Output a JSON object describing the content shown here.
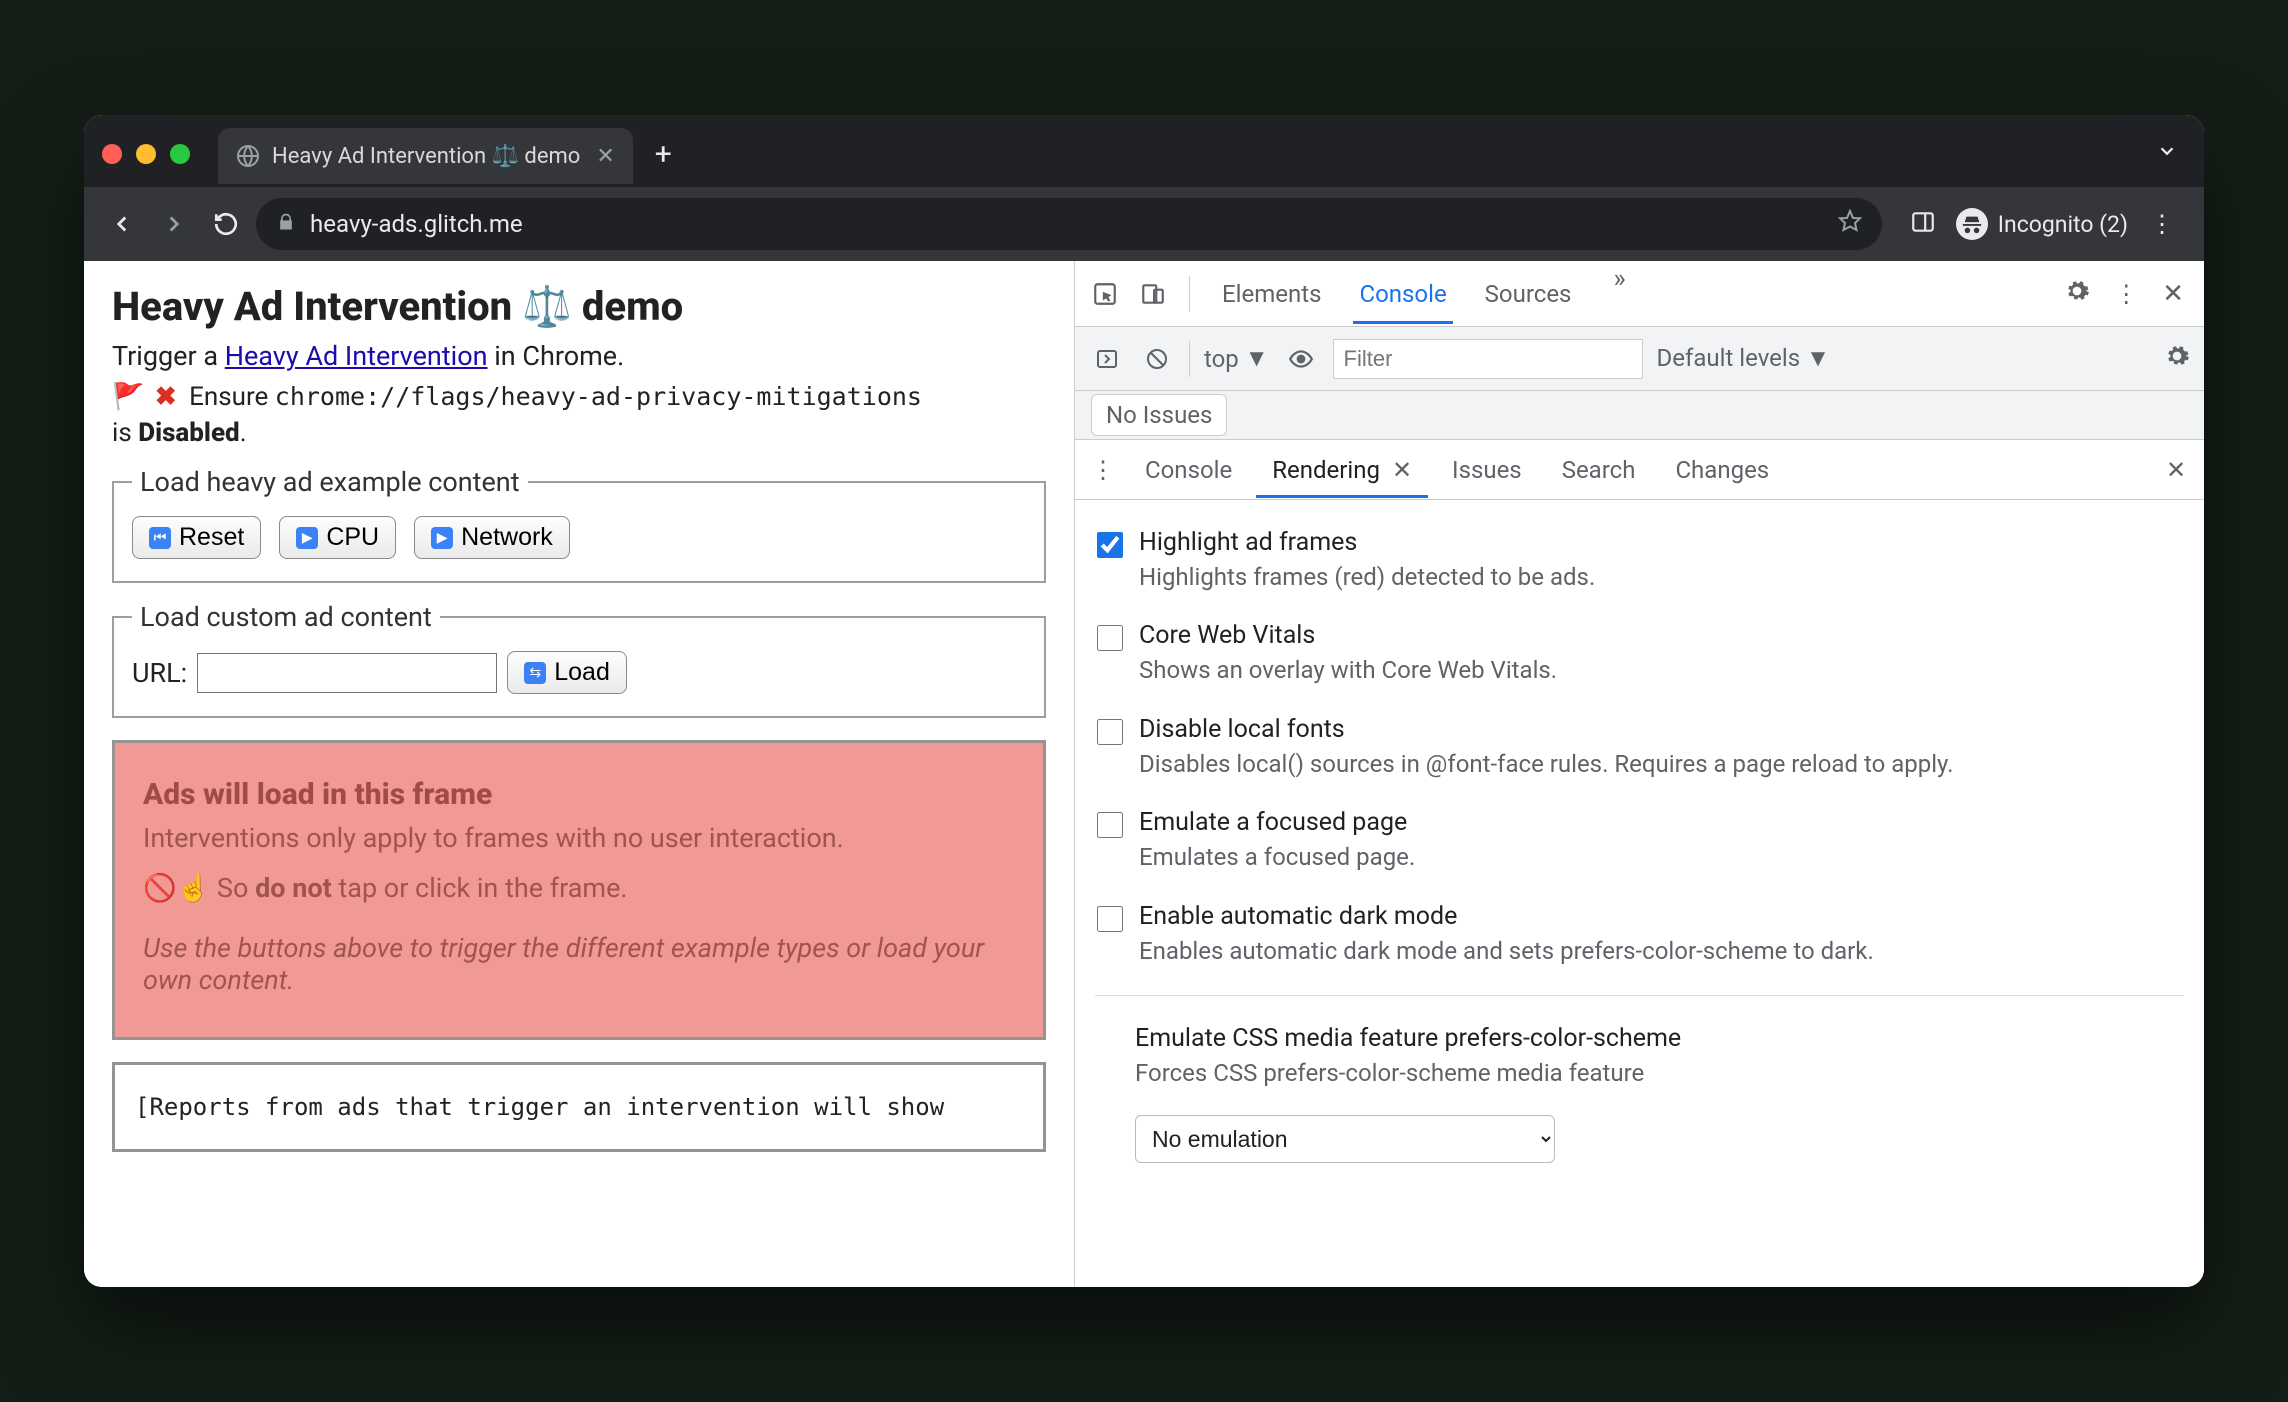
{
  "browser": {
    "tab_title": "Heavy Ad Intervention ⚖️ demo",
    "url_display": "heavy-ads.glitch.me",
    "incognito_label": "Incognito (2)"
  },
  "page": {
    "heading": "Heavy Ad Intervention ⚖️ demo",
    "subtext_prefix": "Trigger a ",
    "subtext_link": "Heavy Ad Intervention",
    "subtext_suffix": " in Chrome.",
    "ensure_prefix": "Ensure ",
    "flag_code": "chrome://flags/heavy-ad-privacy-mitigations",
    "ensure_suffix_prefix": "is ",
    "ensure_suffix_bold": "Disabled",
    "ensure_suffix_period": ".",
    "fieldset1_legend": "Load heavy ad example content",
    "btn_reset": "Reset",
    "btn_cpu": "CPU",
    "btn_network": "Network",
    "fieldset2_legend": "Load custom ad content",
    "url_label": "URL:",
    "btn_load": "Load",
    "adframe": {
      "title": "Ads will load in this frame",
      "line1": "Interventions only apply to frames with no user interaction.",
      "line2_prefix": "🚫☝️ So ",
      "line2_bold": "do not",
      "line2_suffix": " tap or click in the frame.",
      "italic": "Use the buttons above to trigger the different example types or load your own content."
    },
    "reports_text": "[Reports from ads that trigger an intervention will show"
  },
  "devtools": {
    "top_tabs": {
      "elements": "Elements",
      "console": "Console",
      "sources": "Sources"
    },
    "console_bar": {
      "context": "top",
      "filter_placeholder": "Filter",
      "levels": "Default levels"
    },
    "issues_chip": "No Issues",
    "drawer_tabs": {
      "console": "Console",
      "rendering": "Rendering",
      "issues": "Issues",
      "search": "Search",
      "changes": "Changes"
    },
    "rendering_options": [
      {
        "checked": true,
        "label": "Highlight ad frames",
        "desc": "Highlights frames (red) detected to be ads."
      },
      {
        "checked": false,
        "label": "Core Web Vitals",
        "desc": "Shows an overlay with Core Web Vitals."
      },
      {
        "checked": false,
        "label": "Disable local fonts",
        "desc": "Disables local() sources in @font-face rules. Requires a page reload to apply."
      },
      {
        "checked": false,
        "label": "Emulate a focused page",
        "desc": "Emulates a focused page."
      },
      {
        "checked": false,
        "label": "Enable automatic dark mode",
        "desc": "Enables automatic dark mode and sets prefers-color-scheme to dark."
      }
    ],
    "emulate_section": {
      "label": "Emulate CSS media feature prefers-color-scheme",
      "desc": "Forces CSS prefers-color-scheme media feature",
      "select_value": "No emulation"
    }
  }
}
